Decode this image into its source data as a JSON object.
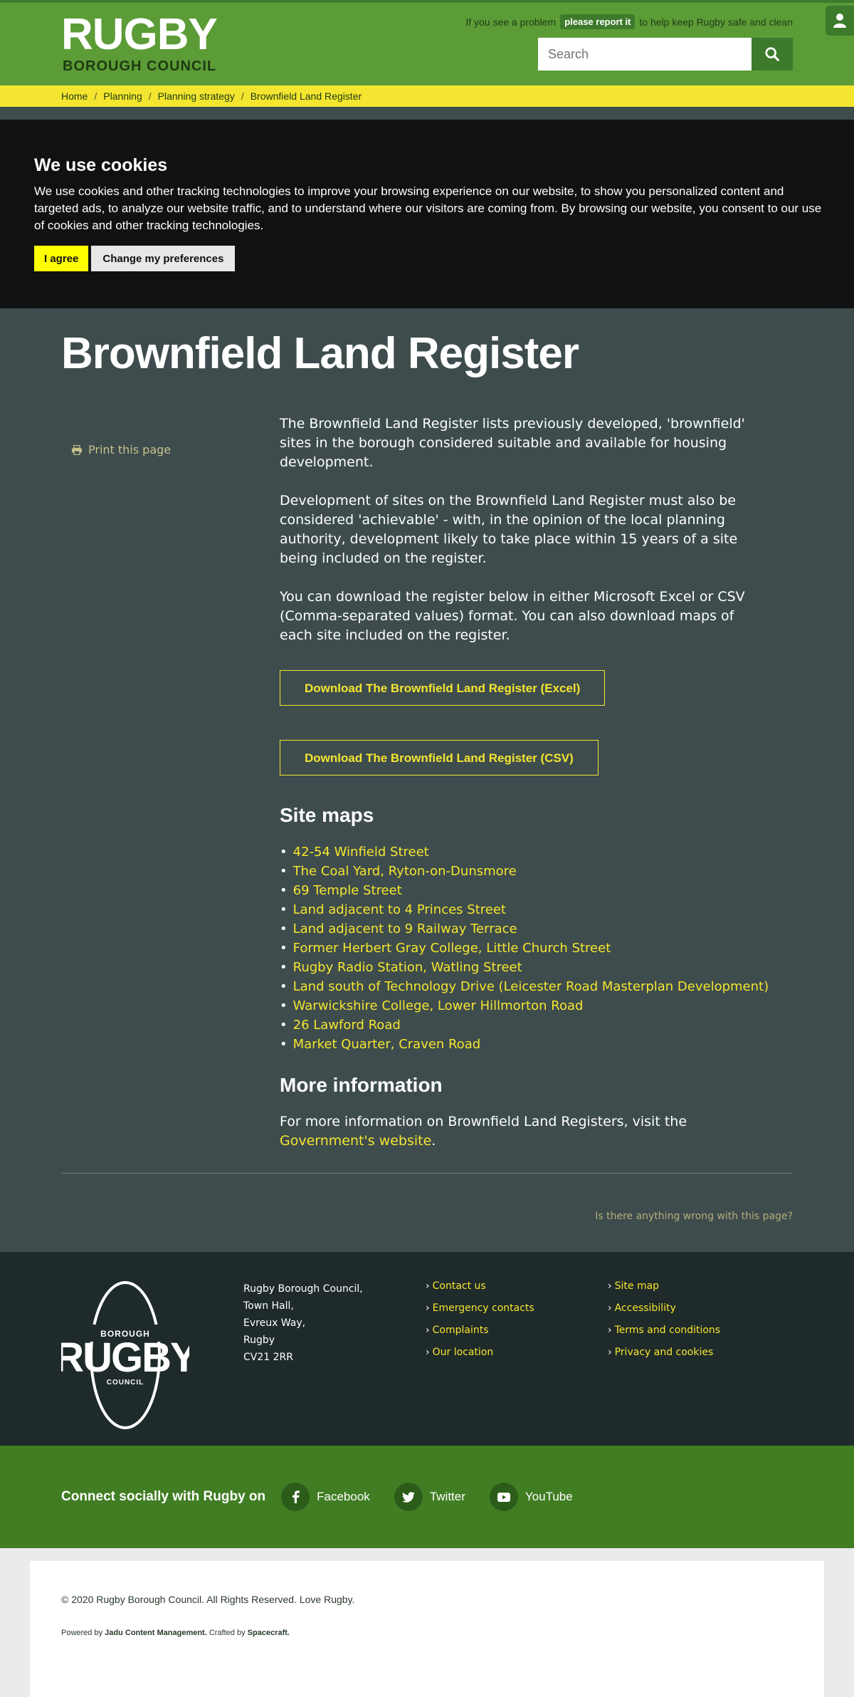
{
  "header": {
    "logo_main": "RUGBY",
    "logo_sub": "BOROUGH COUNCIL",
    "report_prefix": "If you see a problem",
    "report_button": "please report it",
    "report_suffix": "to help keep Rugby safe and clean",
    "search_placeholder": "Search"
  },
  "breadcrumb": [
    "Home",
    "Planning",
    "Planning strategy",
    "Brownfield Land Register"
  ],
  "cookies": {
    "title": "We use cookies",
    "text": "We use cookies and other tracking technologies to improve your browsing experience on our website, to show you personalized content and targeted ads, to analyze our website traffic, and to understand where our visitors are coming from. By browsing our website, you consent to our use of cookies and other tracking technologies.",
    "agree": "I agree",
    "preferences": "Change my preferences"
  },
  "main": {
    "title": "Brownfield Land Register",
    "print": "Print this page",
    "paragraphs": [
      "The Brownfield Land Register lists previously developed, 'brownfield' sites in the borough considered suitable and available for housing development.",
      "Development of sites on the Brownfield Land Register must also be considered 'achievable' - with, in the opinion of the local planning authority, development likely to take place within 15 years of a site being included on the register.",
      "You can download the register below in either Microsoft Excel or CSV (Comma-separated values) format. You can also download maps of each site included on the register."
    ],
    "download_excel": "Download The Brownfield Land Register (Excel)",
    "download_csv": "Download The Brownfield Land Register (CSV)",
    "site_maps_heading": "Site maps",
    "site_maps": [
      "42-54 Winfield Street",
      "The Coal Yard, Ryton-on-Dunsmore",
      "69 Temple Street",
      "Land adjacent to 4 Princes Street",
      "Land adjacent to 9 Railway Terrace",
      "Former Herbert Gray College, Little Church Street",
      "Rugby Radio Station, Watling Street",
      "Land south of Technology Drive (Leicester Road Masterplan Development)",
      "Warwickshire College, Lower Hillmorton Road",
      "26 Lawford Road",
      "Market Quarter, Craven Road"
    ],
    "more_heading": "More information",
    "more_text": "For more information on Brownfield Land Registers, visit the",
    "more_link": "Government's website",
    "more_end": ".",
    "wrong_link": "Is there anything wrong with this page?"
  },
  "footer": {
    "logo_top": "BOROUGH",
    "logo_main": "RUGBY",
    "logo_bottom": "COUNCIL",
    "address": [
      "Rugby Borough Council,",
      "Town Hall,",
      "Evreux Way,",
      "Rugby",
      "CV21 2RR"
    ],
    "links_col1": [
      "Contact us",
      "Emergency contacts",
      "Complaints",
      "Our location"
    ],
    "links_col2": [
      "Site map",
      "Accessibility",
      "Terms and conditions",
      "Privacy and cookies"
    ]
  },
  "social": {
    "title": "Connect socially with Rugby on",
    "facebook": "Facebook",
    "twitter": "Twitter",
    "youtube": "YouTube"
  },
  "copyright": {
    "text": "© 2020 Rugby Borough Council. All Rights Reserved. Love Rugby.",
    "powered_prefix": "Powered by",
    "powered_name": "Jadu Content Management.",
    "crafted_prefix": "Crafted by",
    "crafted_name": "Spacecraft."
  }
}
